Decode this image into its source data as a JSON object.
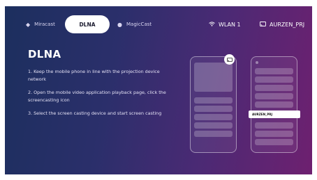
{
  "tabs": [
    {
      "label": "Miracast",
      "icon": "miracast-diamond-icon",
      "active": false
    },
    {
      "label": "DLNA",
      "icon": "",
      "active": true
    },
    {
      "label": "MagicCast",
      "icon": "apple-icon",
      "active": false
    }
  ],
  "status": {
    "wifi_label": "WLAN 1",
    "wifi_icon": "wifi-icon",
    "device_label": "AURZEN_PRJ",
    "device_icon": "cast-screen-icon"
  },
  "main": {
    "title": "DLNA",
    "steps": [
      "1. Keep the mobile phone in line with the projection device network",
      "2. Open the mobile video application playback page, click the screencasting icon",
      "3. Select the screen casting device and start screen casting"
    ]
  },
  "illustration": {
    "device_popup_label": "AURZEN_PRJ",
    "cast_icon": "screencast-icon"
  },
  "colors": {
    "background_start": "#1c2f5e",
    "background_end": "#6e2070",
    "active_tab_bg": "#ffffff",
    "text": "#ffffff"
  }
}
